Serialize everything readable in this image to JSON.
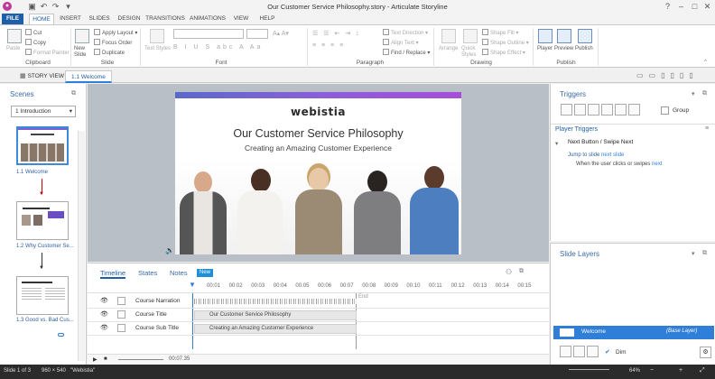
{
  "window": {
    "title": "Our Customer Service Philosophy.story - Articulate Storyline"
  },
  "ribbon_tabs": [
    "FILE",
    "HOME",
    "INSERT",
    "SLIDES",
    "DESIGN",
    "TRANSITIONS",
    "ANIMATIONS",
    "VIEW",
    "HELP"
  ],
  "ribbon": {
    "clipboard": {
      "paste": "Paste",
      "cut": "Cut",
      "copy": "Copy",
      "format_painter": "Format Painter",
      "label": "Clipboard"
    },
    "slide": {
      "new_slide": "New Slide",
      "apply_layout": "Apply Layout",
      "focus_order": "Focus Order",
      "duplicate": "Duplicate",
      "label": "Slide"
    },
    "font": {
      "text_styles": "Text Styles",
      "label": "Font"
    },
    "paragraph": {
      "text_direction": "Text Direction",
      "align_text": "Align Text",
      "find_replace": "Find / Replace",
      "label": "Paragraph"
    },
    "drawing": {
      "arrange": "Arrange",
      "quick_styles": "Quick Styles",
      "shape_fill": "Shape Fill",
      "shape_outline": "Shape Outline",
      "shape_effect": "Shape Effect",
      "label": "Drawing"
    },
    "publish": {
      "player": "Player",
      "preview": "Preview",
      "publish": "Publish",
      "label": "Publish"
    }
  },
  "viewbar": {
    "story_view": "STORY VIEW",
    "current_slide": "1.1 Welcome"
  },
  "scenes": {
    "title": "Scenes",
    "selected_scene": "1 Introduction",
    "slides": [
      {
        "label": "1.1 Welcome"
      },
      {
        "label": "1.2 Why Customer Se..."
      },
      {
        "label": "1.3 Good vs. Bad Cus..."
      }
    ]
  },
  "slide": {
    "logo": "webistia",
    "title": "Our Customer Service Philosophy",
    "subtitle": "Creating an Amazing Customer Experience"
  },
  "timeline": {
    "tabs": [
      "Timeline",
      "States",
      "Notes"
    ],
    "notes_badge": "New",
    "ticks": [
      "00:01",
      "00:02",
      "00:03",
      "00:04",
      "00:05",
      "00:06",
      "00:07",
      "00:08",
      "00:09",
      "00:10",
      "00:11",
      "00:12",
      "00:13",
      "00:14",
      "00:15"
    ],
    "end_label": "End",
    "rows": [
      {
        "name": "Course Narration",
        "bar": ""
      },
      {
        "name": "Course Title",
        "bar": "Our Customer Service Philosophy"
      },
      {
        "name": "Course Sub Title",
        "bar": "Creating an Amazing Customer Experience"
      }
    ],
    "time": "00:07.35"
  },
  "triggers": {
    "title": "Triggers",
    "group_label": "Group",
    "section": "Player Triggers",
    "item_title": "Next Button / Swipe Next",
    "action_prefix": "Jump to slide",
    "action_link": "next slide",
    "condition_prefix": "When the user clicks or swipes",
    "condition_link": "next"
  },
  "layers": {
    "title": "Slide Layers",
    "base_name": "Welcome",
    "base_tag": "(Base Layer)",
    "dim_label": "Dim"
  },
  "status": {
    "slide": "Slide 1 of 3",
    "size": "960 × 540",
    "theme": "\"Webistia\"",
    "zoom": "64%"
  },
  "colors": {
    "accent": "#1f5fa7",
    "file_tab": "#1f5fa7",
    "selected_blue": "#2f7ed8",
    "status_bg": "#2b2b2b"
  }
}
